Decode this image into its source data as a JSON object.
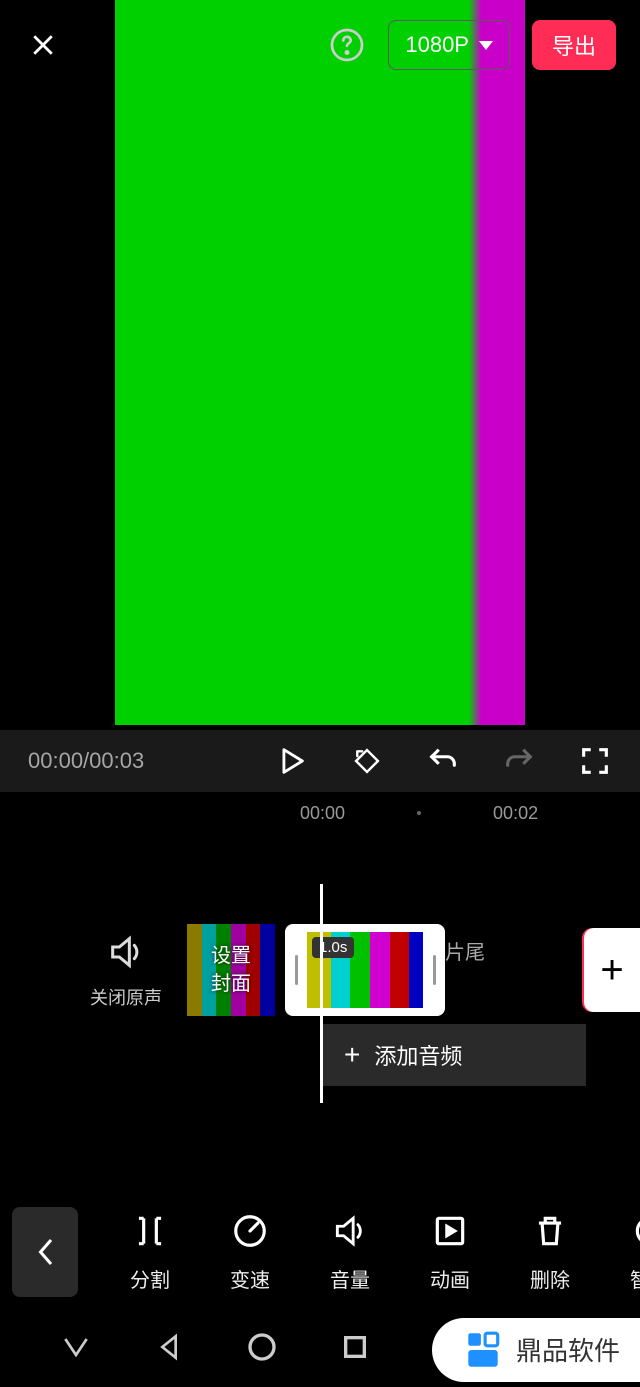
{
  "topbar": {
    "resolution": "1080P",
    "export": "导出"
  },
  "controls": {
    "time": "00:00/00:03"
  },
  "ruler": {
    "t0": "00:00",
    "t1": "00:02"
  },
  "track": {
    "mute_label": "关闭原声",
    "cover_l1": "设置",
    "cover_l2": "封面",
    "clip_duration": "1.0s",
    "tail": "片尾",
    "add": "+",
    "add_audio": "添加音频"
  },
  "tools": {
    "split": "分割",
    "speed": "变速",
    "volume": "音量",
    "anim": "动画",
    "delete": "删除",
    "smart": "智能"
  },
  "brand": "鼎品软件"
}
